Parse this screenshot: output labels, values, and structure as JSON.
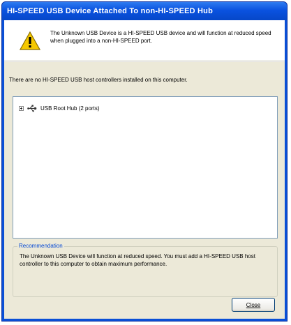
{
  "dialog": {
    "title": "HI-SPEED USB Device Attached To non-HI-SPEED Hub",
    "warning_text": "The Unknown USB Device is a HI-SPEED USB device and will function at reduced speed when plugged into a non-HI-SPEED port.",
    "info_text": "There are no HI-SPEED USB host controllers installed on this computer.",
    "tree": {
      "items": [
        {
          "label": "USB Root Hub (2 ports)",
          "icon": "usb-hub-icon",
          "expander": "plus-expander"
        }
      ]
    },
    "recommendation": {
      "legend": "Recommendation",
      "text": "The Unknown USB Device will function at reduced speed. You must add a HI-SPEED USB host controller to this computer to obtain maximum performance."
    },
    "buttons": {
      "close_label": "Close"
    }
  },
  "colors": {
    "titlebar": "#0a52e0",
    "dialog_bg": "#ece9d8",
    "legend_text": "#0046d5",
    "warning_yellow": "#f5c800"
  }
}
